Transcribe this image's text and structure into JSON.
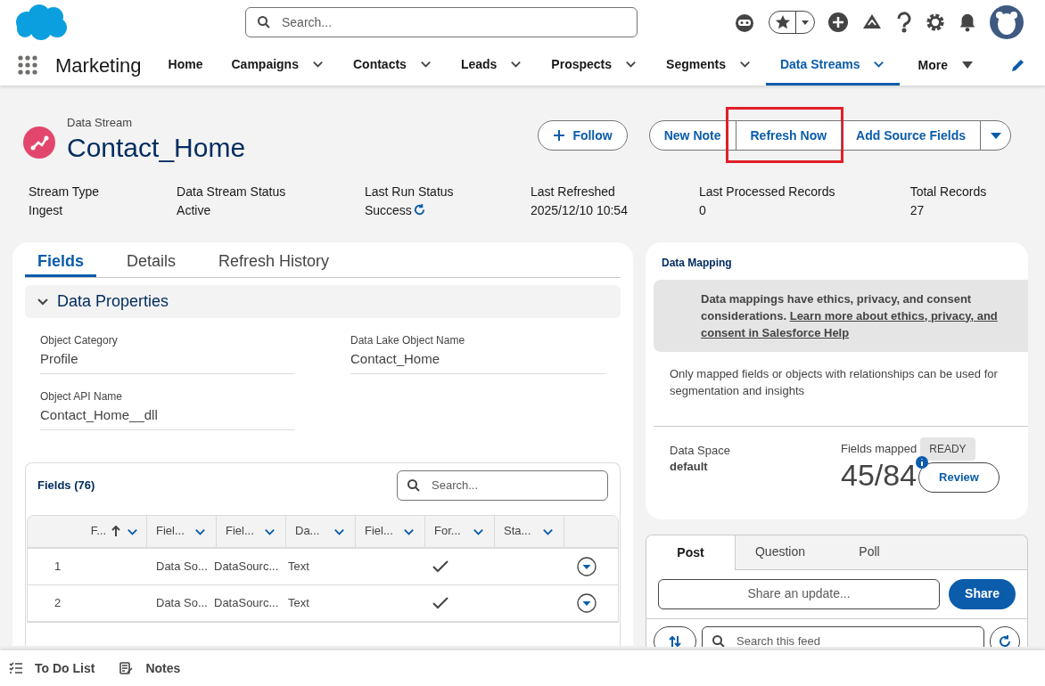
{
  "global_header": {
    "search": {
      "placeholder": "Search..."
    }
  },
  "nav": {
    "app_name": "Marketing",
    "items": [
      {
        "label": "Home",
        "selected": false,
        "has_menu": false
      },
      {
        "label": "Campaigns",
        "selected": false,
        "has_menu": true
      },
      {
        "label": "Contacts",
        "selected": false,
        "has_menu": true
      },
      {
        "label": "Leads",
        "selected": false,
        "has_menu": true
      },
      {
        "label": "Prospects",
        "selected": false,
        "has_menu": true
      },
      {
        "label": "Segments",
        "selected": false,
        "has_menu": true
      },
      {
        "label": "Data Streams",
        "selected": true,
        "has_menu": true
      }
    ],
    "more": "More"
  },
  "record": {
    "object_type": "Data Stream",
    "title": "Contact_Home",
    "follow": "Follow",
    "actions": [
      {
        "label": "New Note",
        "highlighted": false
      },
      {
        "label": "Refresh Now",
        "highlighted": true
      },
      {
        "label": "Add Source Fields",
        "highlighted": false
      }
    ],
    "highlights": [
      {
        "label": "Stream Type",
        "value": "Ingest",
        "refresh_icon": false
      },
      {
        "label": "Data Stream Status",
        "value": "Active",
        "refresh_icon": false
      },
      {
        "label": "Last Run Status",
        "value": "Success",
        "refresh_icon": true
      },
      {
        "label": "Last Refreshed",
        "value": "2025/12/10 10:54",
        "refresh_icon": false
      },
      {
        "label": "Last Processed Records",
        "value": "0",
        "refresh_icon": false
      },
      {
        "label": "Total Records",
        "value": "27",
        "refresh_icon": false
      }
    ]
  },
  "tabs": [
    {
      "label": "Fields",
      "selected": true
    },
    {
      "label": "Details",
      "selected": false
    },
    {
      "label": "Refresh History",
      "selected": false
    }
  ],
  "section": {
    "title": "Data Properties",
    "expanded": true,
    "fields": [
      {
        "label": "Object Category",
        "value": "Profile"
      },
      {
        "label": "Data Lake Object Name",
        "value": "Contact_Home"
      },
      {
        "label": "Object API Name",
        "value": "Contact_Home__dll"
      }
    ]
  },
  "fields_table": {
    "title": "Fields (76)",
    "search_placeholder": "Search...",
    "columns": [
      {
        "label": "F...",
        "sorted": true
      },
      {
        "label": "Fiel...",
        "sorted": false
      },
      {
        "label": "Fiel...",
        "sorted": false
      },
      {
        "label": "Da...",
        "sorted": false
      },
      {
        "label": "Fiel...",
        "sorted": false
      },
      {
        "label": "For...",
        "sorted": false
      },
      {
        "label": "Sta...",
        "sorted": false
      }
    ],
    "rows": [
      {
        "number": "1",
        "column_2": "Data So...",
        "column_3": "DataSourc...",
        "column_4": "Text",
        "checked": true
      },
      {
        "number": "2",
        "column_2": "Data So...",
        "column_3": "DataSourc...",
        "column_4": "Text",
        "checked": true
      }
    ]
  },
  "data_mapping": {
    "title": "Data Mapping",
    "notice": "Data mappings have ethics, privacy, and consent considerations.",
    "notice_link": "Learn more about ethics, privacy, and consent in Salesforce Help",
    "note": "Only mapped fields or objects with relationships can be used for segmentation and insights",
    "data_space_label": "Data Space",
    "data_space_value": "default",
    "fields_mapped_label": "Fields mapped",
    "status": "READY",
    "count": "45/84",
    "review": "Review"
  },
  "feed": {
    "tabs": [
      {
        "label": "Post",
        "selected": true
      },
      {
        "label": "Question",
        "selected": false
      },
      {
        "label": "Poll",
        "selected": false
      }
    ],
    "placeholder": "Share an update...",
    "share": "Share",
    "search_placeholder": "Search this feed"
  },
  "utility_bar": [
    {
      "label": "To Do List",
      "kind": "todo"
    },
    {
      "label": "Notes",
      "kind": "notes"
    }
  ]
}
